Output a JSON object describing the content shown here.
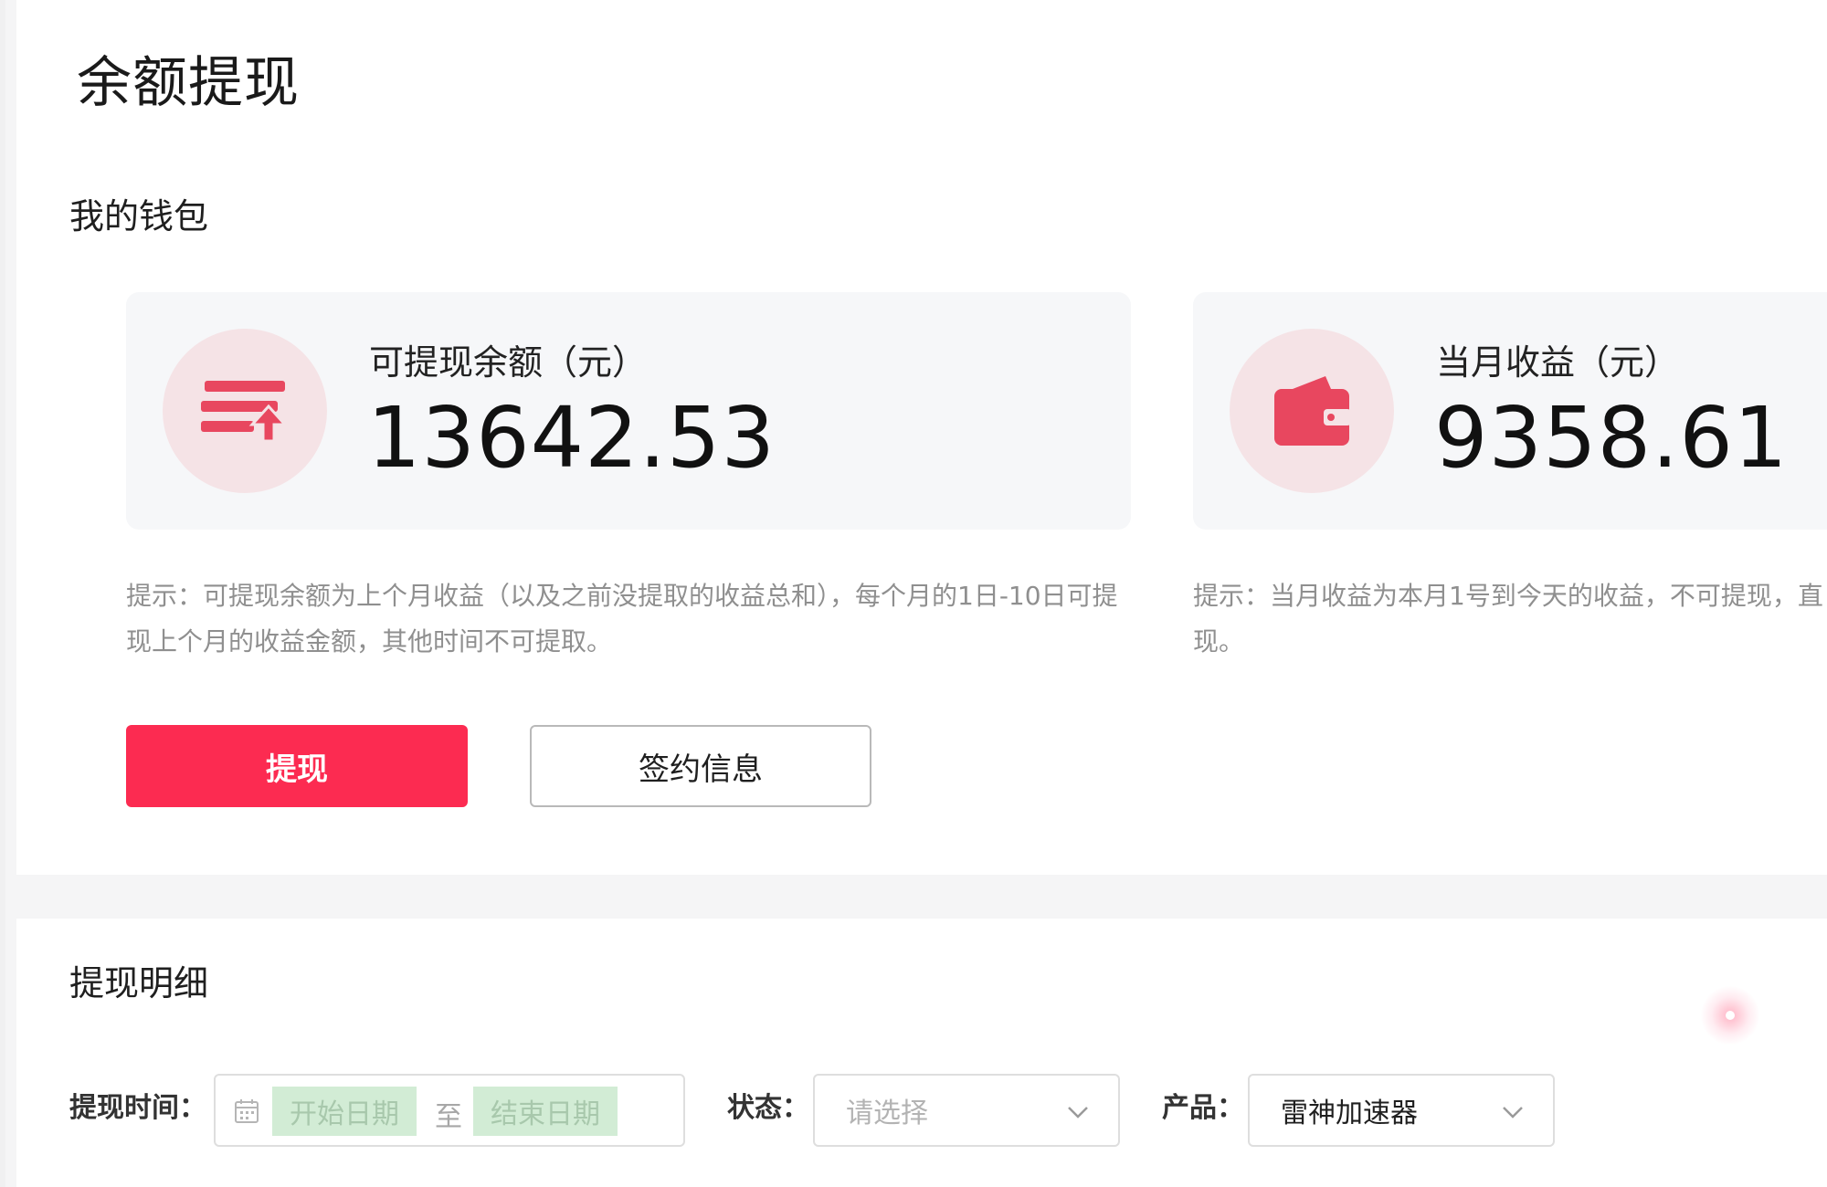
{
  "page": {
    "title": "余额提现"
  },
  "wallet": {
    "section_title": "我的钱包",
    "withdrawable": {
      "label": "可提现余额（元）",
      "value": "13642.53",
      "icon": "withdraw-list-icon",
      "tip": "提示：可提现余额为上个月收益（以及之前没提取的收益总和），每个月的1日-10日可提现上个月的收益金额，其他时间不可提取。"
    },
    "monthly": {
      "label": "当月收益（元）",
      "value": "9358.61",
      "icon": "wallet-icon",
      "tip": "提示：当月收益为本月1号到今天的收益，不可提现，直现。"
    },
    "buttons": {
      "withdraw": "提现",
      "contract": "签约信息"
    }
  },
  "details": {
    "section_title": "提现明细",
    "filters": {
      "time_label": "提现时间：",
      "start_placeholder": "开始日期",
      "range_sep": "至",
      "end_placeholder": "结束日期",
      "status_label": "状态：",
      "status_placeholder": "请选择",
      "product_label": "产品：",
      "product_value": "雷神加速器"
    }
  },
  "colors": {
    "accent": "#fc2b51",
    "icon_bg": "#f5e3e6",
    "icon_fg": "#e8475f",
    "card_bg": "#f6f7f9",
    "date_chip": "#d2ecd5"
  }
}
